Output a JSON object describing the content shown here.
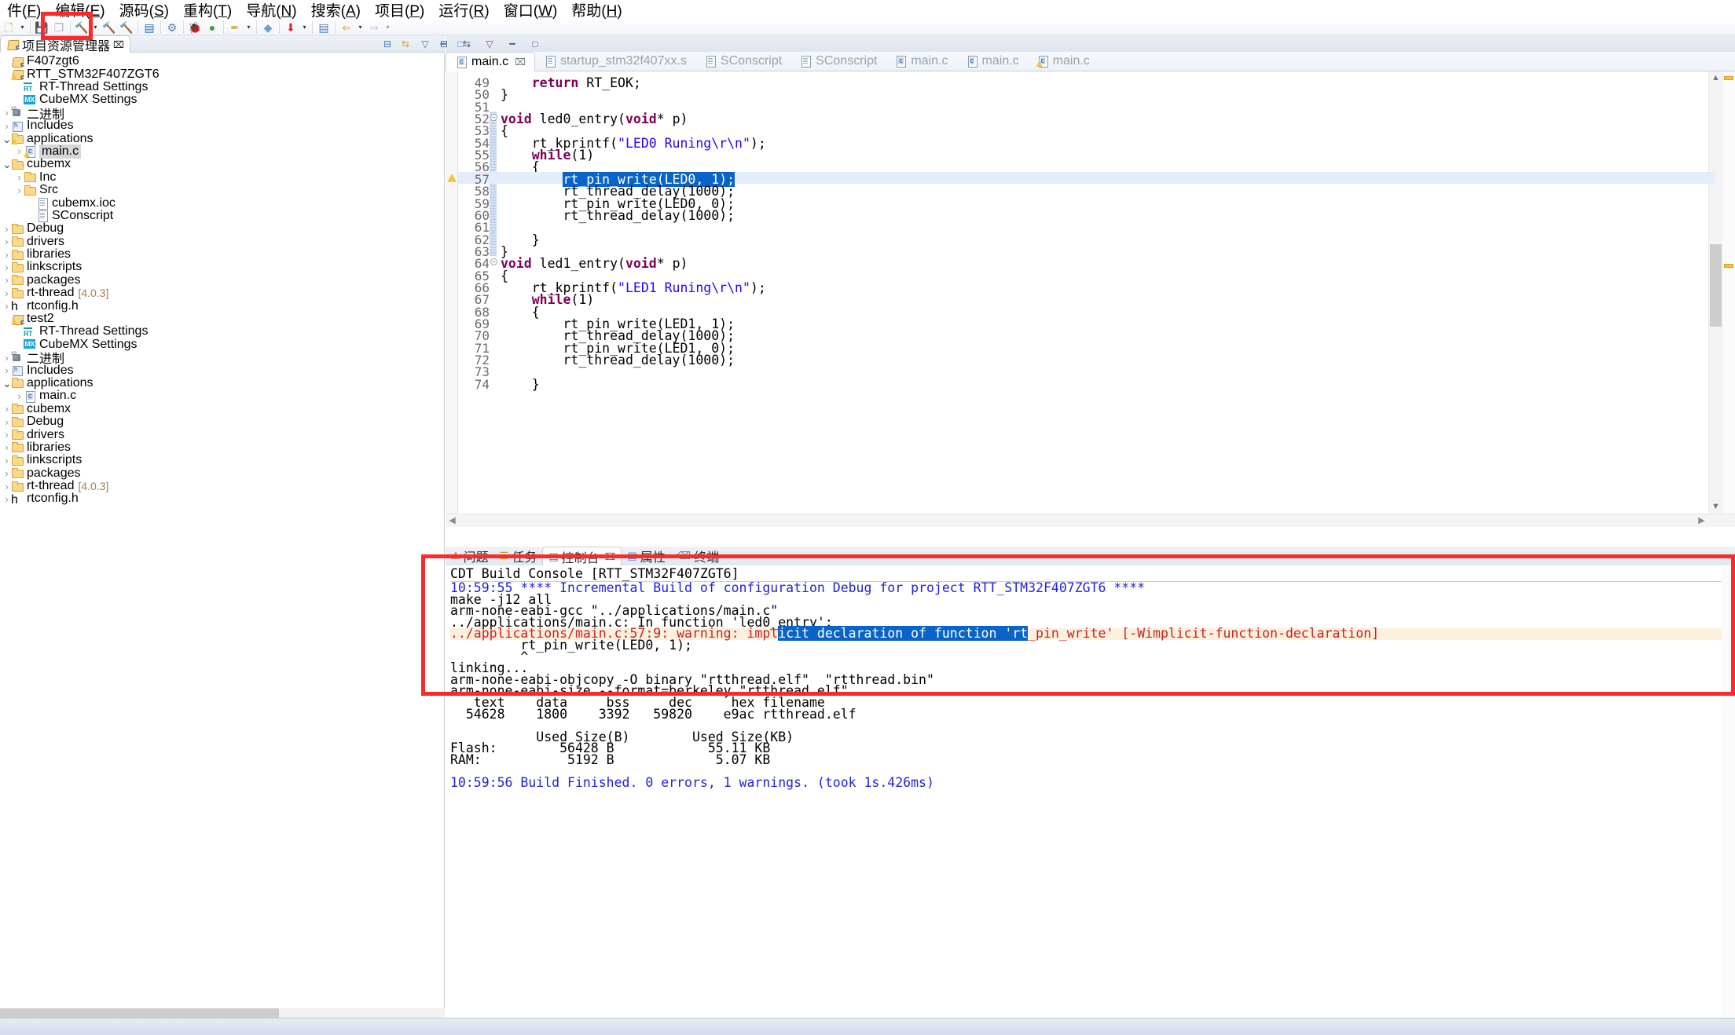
{
  "menu": {
    "items": [
      {
        "label": "件(F)",
        "mnemonic": "F"
      },
      {
        "label": "编辑(E)",
        "mnemonic": "E"
      },
      {
        "label": "源码(S)",
        "mnemonic": "S"
      },
      {
        "label": "重构(T)",
        "mnemonic": "T"
      },
      {
        "label": "导航(N)",
        "mnemonic": "N"
      },
      {
        "label": "搜索(A)",
        "mnemonic": "A"
      },
      {
        "label": "项目(P)",
        "mnemonic": "P"
      },
      {
        "label": "运行(R)",
        "mnemonic": "R"
      },
      {
        "label": "窗口(W)",
        "mnemonic": "W"
      },
      {
        "label": "帮助(H)",
        "mnemonic": "H"
      }
    ]
  },
  "toolbar": {
    "icons": [
      {
        "name": "new-wizard-icon",
        "glyph": "🗋",
        "color": "#d7a03a"
      },
      {
        "name": "new-dropdown-icon",
        "glyph": "▾",
        "color": "#333333"
      },
      {
        "name": "save-icon",
        "glyph": "💾",
        "color": "#a8b0bc"
      },
      {
        "name": "save-all-icon",
        "glyph": "❐",
        "color": "#a8b0bc"
      },
      {
        "name": "build-hammer-icon",
        "glyph": "🔨",
        "color": "#8a6a4a"
      },
      {
        "name": "build-dropdown-icon",
        "glyph": "▾",
        "color": "#333333"
      },
      {
        "name": "clean-hammer-icon",
        "glyph": "🔨",
        "color": "#c08a40"
      },
      {
        "name": "build-all-icon",
        "glyph": "🔨",
        "color": "#c7cdd6"
      },
      {
        "name": "console-view-icon",
        "glyph": "▤",
        "color": "#2a6fbb"
      },
      {
        "name": "gear-icon",
        "glyph": "⚙",
        "color": "#5a7fae"
      },
      {
        "name": "debug-bug-icon",
        "glyph": "🐞",
        "color": "#c0a030"
      },
      {
        "name": "run-external-tools-icon",
        "glyph": "●",
        "color": "#3c9f3c"
      },
      {
        "name": "paint-brush-icon",
        "glyph": "✒",
        "color": "#d8a23a"
      },
      {
        "name": "brush-dropdown-icon",
        "glyph": "▾",
        "color": "#333333"
      },
      {
        "name": "book-icon",
        "glyph": "◆",
        "color": "#6aa0d8"
      },
      {
        "name": "download-flash-icon",
        "glyph": "⬇",
        "color": "#d03030"
      },
      {
        "name": "download-dropdown-icon",
        "glyph": "▾",
        "color": "#333333"
      },
      {
        "name": "properties-icon",
        "glyph": "▤",
        "color": "#4a7ab5"
      },
      {
        "name": "back-arrow-icon",
        "glyph": "⇐",
        "color": "#e0a83c"
      },
      {
        "name": "back-dropdown-icon",
        "glyph": "▾",
        "color": "#333333"
      },
      {
        "name": "forward-arrow-icon",
        "glyph": "⇒",
        "color": "#c8ced8"
      },
      {
        "name": "forward-dropdown-icon",
        "glyph": "▾",
        "color": "#999999"
      }
    ]
  },
  "left_panel": {
    "tab_label": "项目资源管理器",
    "tab_close": "⌧",
    "tree": [
      {
        "indent": 0,
        "arrow": "",
        "icon": "proj",
        "label": "F407zgt6",
        "selected": false,
        "warn": false,
        "dim": ""
      },
      {
        "indent": 0,
        "arrow": "",
        "icon": "proj",
        "label": "RTT_STM32F407ZGT6",
        "selected": false,
        "warn": true,
        "dim": ""
      },
      {
        "indent": 1,
        "arrow": "",
        "icon": "rt",
        "label": "RT-Thread Settings",
        "selected": false,
        "warn": false,
        "dim": ""
      },
      {
        "indent": 1,
        "arrow": "",
        "icon": "mx",
        "label": "CubeMX Settings",
        "selected": false,
        "warn": false,
        "dim": ""
      },
      {
        "indent": 0,
        "arrow": ">",
        "icon": "bin",
        "label": "二进制",
        "selected": false,
        "warn": false,
        "dim": ""
      },
      {
        "indent": 0,
        "arrow": ">",
        "icon": "inc",
        "label": "Includes",
        "selected": false,
        "warn": false,
        "dim": ""
      },
      {
        "indent": 0,
        "arrow": "v",
        "icon": "folder",
        "label": "applications",
        "selected": false,
        "warn": true,
        "dim": ""
      },
      {
        "indent": 1,
        "arrow": ">",
        "icon": "c",
        "label": "main.c",
        "selected": true,
        "warn": true,
        "dim": ""
      },
      {
        "indent": 0,
        "arrow": "v",
        "icon": "folder",
        "label": "cubemx",
        "selected": false,
        "warn": false,
        "dim": ""
      },
      {
        "indent": 1,
        "arrow": ">",
        "icon": "folder",
        "label": "Inc",
        "selected": false,
        "warn": false,
        "dim": ""
      },
      {
        "indent": 1,
        "arrow": ">",
        "icon": "folder",
        "label": "Src",
        "selected": false,
        "warn": false,
        "dim": ""
      },
      {
        "indent": 2,
        "arrow": "",
        "icon": "file",
        "label": "cubemx.ioc",
        "selected": false,
        "warn": false,
        "dim": ""
      },
      {
        "indent": 2,
        "arrow": "",
        "icon": "file",
        "label": "SConscript",
        "selected": false,
        "warn": false,
        "dim": ""
      },
      {
        "indent": 0,
        "arrow": ">",
        "icon": "folder",
        "label": "Debug",
        "selected": false,
        "warn": false,
        "dim": ""
      },
      {
        "indent": 0,
        "arrow": ">",
        "icon": "folder",
        "label": "drivers",
        "selected": false,
        "warn": false,
        "dim": ""
      },
      {
        "indent": 0,
        "arrow": ">",
        "icon": "folder",
        "label": "libraries",
        "selected": false,
        "warn": false,
        "dim": ""
      },
      {
        "indent": 0,
        "arrow": ">",
        "icon": "folder",
        "label": "linkscripts",
        "selected": false,
        "warn": false,
        "dim": ""
      },
      {
        "indent": 0,
        "arrow": ">",
        "icon": "folder",
        "label": "packages",
        "selected": false,
        "warn": false,
        "dim": ""
      },
      {
        "indent": 0,
        "arrow": ">",
        "icon": "folder",
        "label": "rt-thread",
        "selected": false,
        "warn": false,
        "dim": "[4.0.3]"
      },
      {
        "indent": 0,
        "arrow": ">",
        "icon": "h",
        "label": "rtconfig.h",
        "selected": false,
        "warn": false,
        "dim": ""
      },
      {
        "indent": 0,
        "arrow": "",
        "icon": "proj",
        "label": "test2",
        "selected": false,
        "warn": true,
        "dim": ""
      },
      {
        "indent": 1,
        "arrow": "",
        "icon": "rt",
        "label": "RT-Thread Settings",
        "selected": false,
        "warn": false,
        "dim": ""
      },
      {
        "indent": 1,
        "arrow": "",
        "icon": "mx",
        "label": "CubeMX Settings",
        "selected": false,
        "warn": false,
        "dim": ""
      },
      {
        "indent": 0,
        "arrow": ">",
        "icon": "bin",
        "label": "二进制",
        "selected": false,
        "warn": false,
        "dim": ""
      },
      {
        "indent": 0,
        "arrow": ">",
        "icon": "inc",
        "label": "Includes",
        "selected": false,
        "warn": false,
        "dim": ""
      },
      {
        "indent": 0,
        "arrow": "v",
        "icon": "folder",
        "label": "applications",
        "selected": false,
        "warn": false,
        "dim": ""
      },
      {
        "indent": 1,
        "arrow": ">",
        "icon": "c",
        "label": "main.c",
        "selected": false,
        "warn": false,
        "dim": ""
      },
      {
        "indent": 0,
        "arrow": ">",
        "icon": "folder",
        "label": "cubemx",
        "selected": false,
        "warn": false,
        "dim": ""
      },
      {
        "indent": 0,
        "arrow": ">",
        "icon": "folder",
        "label": "Debug",
        "selected": false,
        "warn": false,
        "dim": ""
      },
      {
        "indent": 0,
        "arrow": ">",
        "icon": "folder",
        "label": "drivers",
        "selected": false,
        "warn": false,
        "dim": ""
      },
      {
        "indent": 0,
        "arrow": ">",
        "icon": "folder",
        "label": "libraries",
        "selected": false,
        "warn": false,
        "dim": ""
      },
      {
        "indent": 0,
        "arrow": ">",
        "icon": "folder",
        "label": "linkscripts",
        "selected": false,
        "warn": false,
        "dim": ""
      },
      {
        "indent": 0,
        "arrow": ">",
        "icon": "folder",
        "label": "packages",
        "selected": false,
        "warn": false,
        "dim": ""
      },
      {
        "indent": 0,
        "arrow": ">",
        "icon": "folder",
        "label": "rt-thread",
        "selected": false,
        "warn": false,
        "dim": "[4.0.3]"
      },
      {
        "indent": 0,
        "arrow": ">",
        "icon": "h",
        "label": "rtconfig.h",
        "selected": false,
        "warn": false,
        "dim": ""
      }
    ]
  },
  "editor": {
    "header_buttons": [
      {
        "name": "collapse-all-icon",
        "glyph": "⊟"
      },
      {
        "name": "link-with-editor-icon",
        "glyph": "⇆"
      },
      {
        "name": "view-menu-icon",
        "glyph": "▽"
      },
      {
        "name": "minimize-icon",
        "glyph": "━"
      },
      {
        "name": "maximize-icon",
        "glyph": "□"
      }
    ],
    "editor_buttons": [
      {
        "name": "editor-minimize-icon",
        "glyph": "━"
      },
      {
        "name": "editor-maximize-icon",
        "glyph": "□"
      }
    ],
    "tabs": [
      {
        "label": "main.c",
        "icon": "c",
        "active": true,
        "warn": false,
        "closeable": true
      },
      {
        "label": "startup_stm32f407xx.s",
        "icon": "asm",
        "active": false,
        "warn": false,
        "closeable": false
      },
      {
        "label": "SConscript",
        "icon": "file",
        "active": false,
        "warn": false,
        "closeable": false
      },
      {
        "label": "SConscript",
        "icon": "file",
        "active": false,
        "warn": false,
        "closeable": false
      },
      {
        "label": "main.c",
        "icon": "c",
        "active": false,
        "warn": false,
        "closeable": false
      },
      {
        "label": "main.c",
        "icon": "c",
        "active": false,
        "warn": false,
        "closeable": false
      },
      {
        "label": "main.c",
        "icon": "c",
        "active": false,
        "warn": true,
        "closeable": false
      }
    ],
    "lines": [
      {
        "num": "49",
        "text": "    return RT_EOK;",
        "marker": "",
        "fold": "",
        "hl": false
      },
      {
        "num": "50",
        "text": "}",
        "marker": "",
        "fold": "",
        "hl": false
      },
      {
        "num": "51",
        "text": "",
        "marker": "",
        "fold": "",
        "hl": false
      },
      {
        "num": "52",
        "text": "void led0_entry(void* p)",
        "marker": "",
        "fold": "-",
        "hl": false
      },
      {
        "num": "53",
        "text": "{",
        "marker": "",
        "fold": "",
        "hl": false
      },
      {
        "num": "54",
        "text": "    rt_kprintf(\"LED0 Runing\\r\\n\");",
        "marker": "",
        "fold": "",
        "hl": false
      },
      {
        "num": "55",
        "text": "    while(1)",
        "marker": "",
        "fold": "",
        "hl": false
      },
      {
        "num": "56",
        "text": "    {",
        "marker": "",
        "fold": "",
        "hl": false
      },
      {
        "num": "57",
        "text": "        rt_pin_write(LED0, 1);",
        "marker": "warn",
        "fold": "",
        "hl": true
      },
      {
        "num": "58",
        "text": "        rt_thread_delay(1000);",
        "marker": "",
        "fold": "",
        "hl": false
      },
      {
        "num": "59",
        "text": "        rt_pin_write(LED0, 0);",
        "marker": "",
        "fold": "",
        "hl": false
      },
      {
        "num": "60",
        "text": "        rt_thread_delay(1000);",
        "marker": "",
        "fold": "",
        "hl": false
      },
      {
        "num": "61",
        "text": "",
        "marker": "",
        "fold": "",
        "hl": false
      },
      {
        "num": "62",
        "text": "    }",
        "marker": "",
        "fold": "",
        "hl": false
      },
      {
        "num": "63",
        "text": "}",
        "marker": "",
        "fold": "",
        "hl": false
      },
      {
        "num": "64",
        "text": "void led1_entry(void* p)",
        "marker": "",
        "fold": "-",
        "hl": false
      },
      {
        "num": "65",
        "text": "{",
        "marker": "",
        "fold": "",
        "hl": false
      },
      {
        "num": "66",
        "text": "    rt_kprintf(\"LED1 Runing\\r\\n\");",
        "marker": "",
        "fold": "",
        "hl": false
      },
      {
        "num": "67",
        "text": "    while(1)",
        "marker": "",
        "fold": "",
        "hl": false
      },
      {
        "num": "68",
        "text": "    {",
        "marker": "",
        "fold": "",
        "hl": false
      },
      {
        "num": "69",
        "text": "        rt_pin_write(LED1, 1);",
        "marker": "",
        "fold": "",
        "hl": false
      },
      {
        "num": "70",
        "text": "        rt_thread_delay(1000);",
        "marker": "",
        "fold": "",
        "hl": false
      },
      {
        "num": "71",
        "text": "        rt_pin_write(LED1, 0);",
        "marker": "",
        "fold": "",
        "hl": false
      },
      {
        "num": "72",
        "text": "        rt_thread_delay(1000);",
        "marker": "",
        "fold": "",
        "hl": false
      },
      {
        "num": "73",
        "text": "",
        "marker": "",
        "fold": "",
        "hl": false
      },
      {
        "num": "74",
        "text": "    }",
        "marker": "",
        "fold": "",
        "hl": false
      }
    ],
    "selected_code": "rt_pin_write(LED0, 1);"
  },
  "console": {
    "tabs": [
      {
        "label": "问题",
        "active": false,
        "closeable": false
      },
      {
        "label": "任务",
        "active": false,
        "closeable": false
      },
      {
        "label": "控制台",
        "active": true,
        "closeable": true
      },
      {
        "label": "属性",
        "active": false,
        "closeable": false
      },
      {
        "label": "终端",
        "active": false,
        "closeable": false
      }
    ],
    "title": "CDT Build Console [RTT_STM32F407ZGT6]",
    "lines": [
      {
        "text": "10:59:55 **** Incremental Build of configuration Debug for project RTT_STM32F407ZGT6 ****",
        "style": "blue"
      },
      {
        "text": "make -j12 all",
        "style": "plain"
      },
      {
        "text": "arm-none-eabi-gcc \"../applications/main.c\"",
        "style": "plain"
      },
      {
        "text": "../applications/main.c: In function 'led0_entry':",
        "style": "plain"
      },
      {
        "text": "../applications/main.c:57:9: warning: implicit declaration of function 'rt_pin_write' [-Wimplicit-function-declaration]",
        "style": "warning",
        "sel_start": 42,
        "sel_end": 74
      },
      {
        "text": "         rt_pin_write(LED0, 1);",
        "style": "plain"
      },
      {
        "text": "         ^",
        "style": "plain"
      },
      {
        "text": "linking...",
        "style": "plain"
      },
      {
        "text": "arm-none-eabi-objcopy -O binary \"rtthread.elf\"  \"rtthread.bin\"",
        "style": "plain"
      },
      {
        "text": "arm-none-eabi-size --format=berkeley \"rtthread.elf\"",
        "style": "plain"
      },
      {
        "text": "   text    data     bss     dec     hex filename",
        "style": "plain"
      },
      {
        "text": "  54628    1800    3392   59820    e9ac rtthread.elf",
        "style": "plain"
      },
      {
        "text": "",
        "style": "plain"
      },
      {
        "text": "           Used Size(B)        Used Size(KB)",
        "style": "plain"
      },
      {
        "text": "Flash:        56428 B            55.11 KB",
        "style": "plain"
      },
      {
        "text": "RAM:           5192 B             5.07 KB",
        "style": "plain"
      },
      {
        "text": "",
        "style": "plain"
      },
      {
        "text": "10:59:56 Build Finished. 0 errors, 1 warnings. (took 1s.426ms)",
        "style": "blue"
      }
    ]
  },
  "annotations": {
    "toolbar_box_color": "#fb2b2b",
    "console_box_color": "#fb2b2b"
  }
}
